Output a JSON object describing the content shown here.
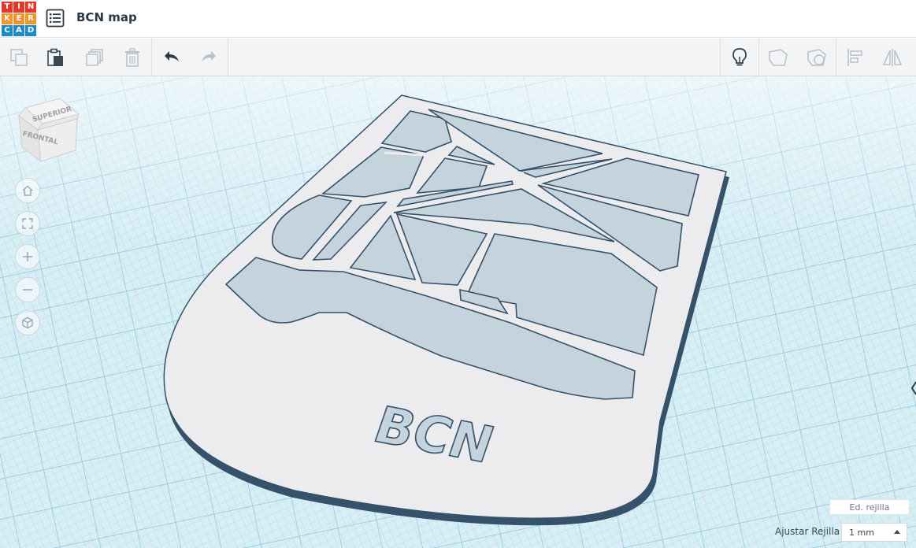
{
  "app": {
    "logo_letters": [
      "T",
      "I",
      "N",
      "K",
      "E",
      "R",
      "C",
      "A",
      "D"
    ],
    "logo_colors": [
      "#e2382a",
      "#e2382a",
      "#e2382a",
      "#f0942b",
      "#f0942b",
      "#f0942b",
      "#1a8ac9",
      "#1a8ac9",
      "#1a8ac9"
    ],
    "design_title": "BCN map"
  },
  "toolbar": {
    "copy_icon": "copy-icon",
    "paste_icon": "paste-icon",
    "duplicate_icon": "duplicate-icon",
    "delete_icon": "trash-icon",
    "undo_icon": "undo-icon",
    "redo_icon": "redo-icon",
    "notes_icon": "lightbulb-icon",
    "hole_icon": "shape-hole-icon",
    "group_icon": "group-icon",
    "align_icon": "align-icon",
    "mirror_icon": "mirror-icon"
  },
  "viewcube": {
    "top_face": "SUPERIOR",
    "front_face": "FRONTAL"
  },
  "model_text": "BCN",
  "grid": {
    "edit_label": "Ed. rejilla",
    "snap_label": "Ajustar Rejilla",
    "snap_value": "1 mm"
  },
  "colors": {
    "grid_bg": "#d8eef5",
    "grid_line": "#9fd0e2",
    "model_fill": "#ececee",
    "model_edge": "#35526a"
  }
}
